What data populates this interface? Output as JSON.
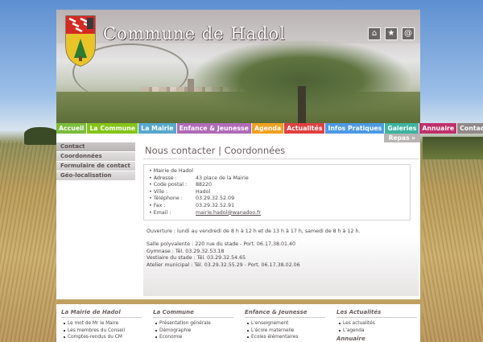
{
  "site": {
    "title": "Commune de Hadol"
  },
  "toolbar": {
    "icons": [
      {
        "name": "home-icon",
        "glyph": "⌂"
      },
      {
        "name": "star-icon",
        "glyph": "★"
      },
      {
        "name": "email-icon",
        "glyph": "@"
      }
    ]
  },
  "nav": {
    "items": [
      {
        "label": "Accueil",
        "color": "#7cbc3c"
      },
      {
        "label": "La Commune",
        "color": "#84c418"
      },
      {
        "label": "La Mairie",
        "color": "#58a8cc"
      },
      {
        "label": "Enfance & Jeunesse",
        "color": "#b06ab8"
      },
      {
        "label": "Agenda",
        "color": "#f0a020"
      },
      {
        "label": "Actualités",
        "color": "#e04040"
      },
      {
        "label": "Infos Pratiques",
        "color": "#4c9ae4"
      },
      {
        "label": "Galeries",
        "color": "#3cb4a0"
      },
      {
        "label": "Annuaire",
        "color": "#c0306a"
      },
      {
        "label": "Contact",
        "color": "#908888"
      }
    ],
    "sub_label": "Repas »"
  },
  "sidebar": {
    "items": [
      {
        "label": "Contact"
      },
      {
        "label": "Coordonnées"
      },
      {
        "label": "Formulaire de contact"
      },
      {
        "label": "Géo-localisation"
      }
    ]
  },
  "content": {
    "title": "Nous contacter | Coordonnées",
    "name": "• Mairie de Hadol",
    "fields": [
      {
        "label": "• Adresse :",
        "value": "43 place de la Mairie"
      },
      {
        "label": "• Code postal :",
        "value": "88220"
      },
      {
        "label": "• Ville :",
        "value": "Hadol"
      },
      {
        "label": "• Téléphone :",
        "value": "03.29.32.52.09"
      },
      {
        "label": "• Fax :",
        "value": "03.29.32.52.91"
      }
    ],
    "email_label": "• Email :",
    "email_value": "mairie.hadol@wanadoo.fr",
    "hours": "Ouverture : lundi au vendredi de 8 h à 12 h et de 13 h à 17 h, samedi de 8 h à 12 h.",
    "lines": [
      "Salle polyvalente : 220 rue du stade - Port. 06.17.38.01.40",
      "Gymnase : Tél. 03.29.32.53.18",
      "Vestiaire du stade : Tél. 03.29.32.54.65",
      "Atelier municipal : Tél. 03.29.32.55.29 - Port. 06.17.38.02.06"
    ]
  },
  "footer": {
    "columns": [
      {
        "heading": "La Mairie de Hadol",
        "links": [
          "Le mot de Mr le Maire",
          "Les membres du Conseil",
          "Comptes-rendus du CM"
        ]
      },
      {
        "heading": "La Commune",
        "links": [
          "Présentation générale",
          "Démographie",
          "Economie"
        ]
      },
      {
        "heading": "Enfance & Jeunesse",
        "links": [
          "L'enseignement",
          "L'école maternelle",
          "Ecoles élémentaires"
        ]
      },
      {
        "heading": "Les Actualités",
        "links": [
          "Les actualités",
          "L'agenda"
        ],
        "next_heading": "Annuaire"
      }
    ]
  }
}
